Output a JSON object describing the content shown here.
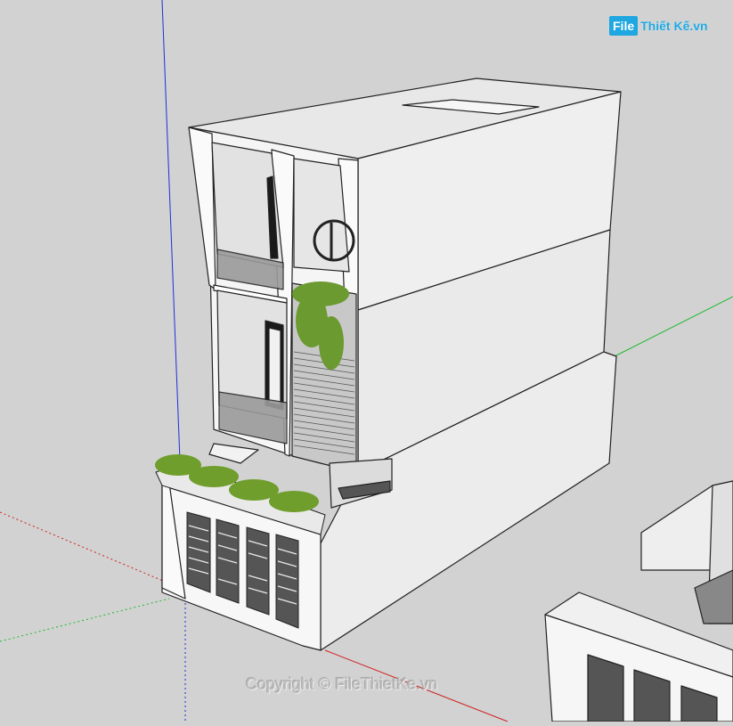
{
  "watermark": {
    "logo_box": "File",
    "logo_text": "Thiết Kế.vn",
    "copyright": "Copyright © FileThietKe.vn"
  },
  "colors": {
    "background": "#d2d2d2",
    "axis_blue": "#1f2fd8",
    "axis_green": "#1fb82f",
    "axis_red": "#d01f1f",
    "wall": "#f2f2f2",
    "wall_side": "#e6e6e6",
    "edge": "#222222",
    "glass": "#9a9a9a",
    "plant": "#5f8a2a",
    "logo_blue": "#1ea7e1"
  },
  "icons": [
    "house-model-icon"
  ]
}
